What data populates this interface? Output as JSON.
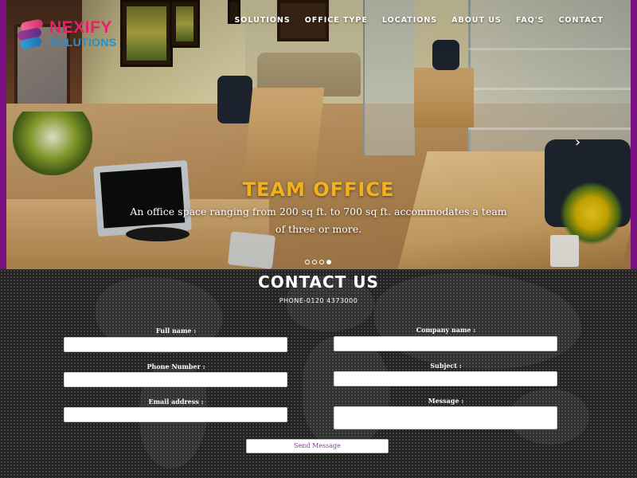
{
  "brand": {
    "name_top": "NEXIFY",
    "name_bottom": "SOLUTIONS",
    "colors": {
      "primary": "#e8216b",
      "secondary": "#2590cf",
      "frame": "#7a0f82"
    }
  },
  "nav": {
    "items": [
      {
        "label": "SOLUTIONS"
      },
      {
        "label": "OFFICE TYPE"
      },
      {
        "label": "LOCATIONS"
      },
      {
        "label": "ABOUT US"
      },
      {
        "label": "FAQ'S"
      },
      {
        "label": "CONTACT"
      }
    ]
  },
  "hero": {
    "title": "TEAM OFFICE",
    "title_color": "#f3b21b",
    "description": "An office space ranging from 200 sq ft. to 700 sq ft. accommodates a team of three or more.",
    "next_icon": "chevron-right-icon",
    "slide_count": 4,
    "active_slide": 4
  },
  "contact": {
    "title": "CONTACT US",
    "phone": "PHONE-0120 4373000",
    "fields": {
      "full_name": {
        "label": "Full name :",
        "value": ""
      },
      "company_name": {
        "label": "Company name :",
        "value": ""
      },
      "phone_number": {
        "label": "Phone Number :",
        "value": ""
      },
      "subject": {
        "label": "Subject :",
        "value": ""
      },
      "email_address": {
        "label": "Email address :",
        "value": ""
      },
      "message": {
        "label": "Message :",
        "value": ""
      }
    },
    "send_label": "Send Message"
  }
}
